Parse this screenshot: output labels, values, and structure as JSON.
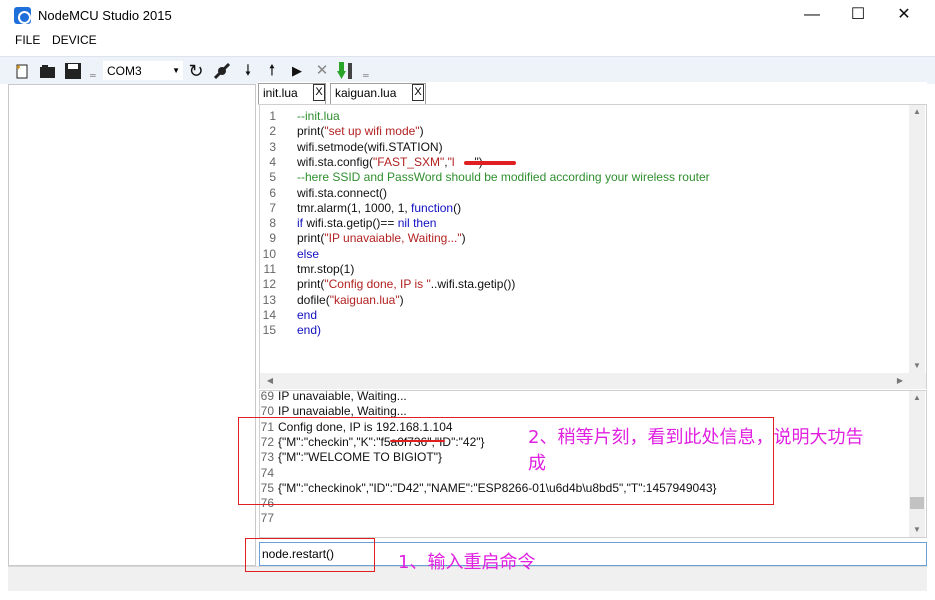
{
  "window": {
    "title": "NodeMCU Studio 2015",
    "minimize": "—",
    "maximize": "☐",
    "close": "✕"
  },
  "menu": [
    "FILE",
    "DEVICE"
  ],
  "toolbar": {
    "port": "COM3",
    "icons": [
      "new-file-icon",
      "open-folder-icon",
      "save-icon",
      "refresh-icon",
      "disconnect-plug-icon",
      "download-arrow-icon",
      "upload-arrow-icon",
      "run-icon",
      "stop-icon",
      "flash-icon"
    ]
  },
  "tabs": [
    {
      "label": "init.lua",
      "close": "X"
    },
    {
      "label": "kaiguan.lua",
      "close": "X"
    }
  ],
  "editor": {
    "lines": [
      {
        "n": "1",
        "segs": [
          [
            "--init.lua",
            "green"
          ]
        ]
      },
      {
        "n": "2",
        "segs": [
          [
            "print(",
            "black"
          ],
          [
            "\"set up wifi mode\"",
            "red"
          ],
          [
            ")",
            "black"
          ]
        ]
      },
      {
        "n": "3",
        "segs": [
          [
            "wifi.setmode(wifi.STATION)",
            "black"
          ]
        ]
      },
      {
        "n": "4",
        "segs": [
          [
            "wifi.sta.config(",
            "black"
          ],
          [
            "\"FAST_SXM\"",
            "red"
          ],
          [
            ",",
            "black"
          ],
          [
            "\"l",
            "red"
          ],
          [
            "      ",
            "red"
          ],
          [
            "\")",
            "black"
          ]
        ]
      },
      {
        "n": "5",
        "segs": [
          [
            "--here SSID and PassWord should be modified according your wireless router",
            "green"
          ]
        ]
      },
      {
        "n": "6",
        "segs": [
          [
            "wifi.sta.connect()",
            "black"
          ]
        ]
      },
      {
        "n": "7",
        "segs": [
          [
            "tmr.alarm(1, 1000, 1, ",
            "black"
          ],
          [
            "function",
            "blue"
          ],
          [
            "()",
            "black"
          ]
        ]
      },
      {
        "n": "8",
        "segs": [
          [
            "if",
            "blue"
          ],
          [
            " wifi.sta.getip()== ",
            "black"
          ],
          [
            "nil",
            "blue"
          ],
          [
            " ",
            "black"
          ],
          [
            "then",
            "blue"
          ]
        ]
      },
      {
        "n": "9",
        "segs": [
          [
            "print(",
            "black"
          ],
          [
            "\"IP unavaiable, Waiting...\"",
            "red"
          ],
          [
            ")",
            "black"
          ]
        ]
      },
      {
        "n": "10",
        "segs": [
          [
            "else",
            "blue"
          ]
        ]
      },
      {
        "n": "11",
        "segs": [
          [
            "tmr.stop(1)",
            "black"
          ]
        ]
      },
      {
        "n": "12",
        "segs": [
          [
            "print(",
            "black"
          ],
          [
            "\"Config done, IP is \"",
            "red"
          ],
          [
            "..wifi.sta.getip())",
            "black"
          ]
        ]
      },
      {
        "n": "13",
        "segs": [
          [
            "dofile(",
            "black"
          ],
          [
            "\"kaiguan.lua\"",
            "red"
          ],
          [
            ")",
            "black"
          ]
        ]
      },
      {
        "n": "14",
        "segs": [
          [
            "end",
            "blue"
          ]
        ]
      },
      {
        "n": "15",
        "segs": [
          [
            "end)",
            "blue"
          ]
        ]
      }
    ]
  },
  "console": {
    "lines": [
      {
        "n": "69",
        "text": "IP unavaiable, Waiting..."
      },
      {
        "n": "70",
        "text": "IP unavaiable, Waiting..."
      },
      {
        "n": "71",
        "text": "Config done, IP is 192.168.1.104"
      },
      {
        "n": "72",
        "text": "{\"M\":\"checkin\",\"K\":\"f5a0f736\",\"ID\":\"42\"}"
      },
      {
        "n": "73",
        "text": "{\"M\":\"WELCOME TO BIGIOT\"}"
      },
      {
        "n": "74",
        "text": ""
      },
      {
        "n": "75",
        "text": "{\"M\":\"checkinok\",\"ID\":\"D42\",\"NAME\":\"ESP8266-01\\u6d4b\\u8bd5\",\"T\":1457949043}"
      },
      {
        "n": "76",
        "text": ""
      },
      {
        "n": "77",
        "text": ""
      }
    ]
  },
  "command_input": {
    "value": "node.restart()"
  },
  "annotations": {
    "step2_line1": "2、稍等片刻，看到此处信息，说明大功告",
    "step2_line2": "成",
    "step1": "1、输入重启命令"
  },
  "colors": {
    "annotation_text": "#e020e0",
    "annotation_box": "#e02020",
    "toolbar_bg": "#eef3fa"
  }
}
